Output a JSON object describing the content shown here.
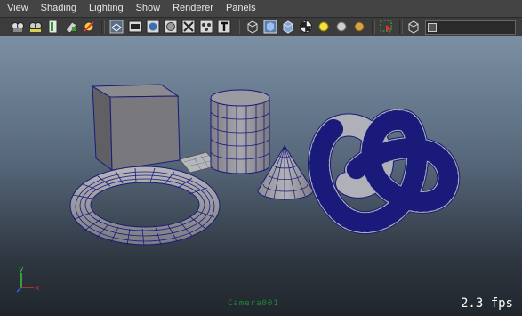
{
  "menubar": {
    "items": [
      {
        "label": "View"
      },
      {
        "label": "Shading"
      },
      {
        "label": "Lighting"
      },
      {
        "label": "Show"
      },
      {
        "label": "Renderer"
      },
      {
        "label": "Panels"
      }
    ]
  },
  "toolbar": {
    "buttons": [
      "camera-select-icon",
      "camera-attributes-icon",
      "bookmark-icon",
      "image-plane-icon",
      "2d-pan-zoom-icon",
      "grid-icon",
      "film-gate-icon",
      "resolution-gate-icon",
      "gate-mask-icon",
      "field-chart-icon",
      "safe-action-icon",
      "safe-title-icon",
      "wireframe-icon",
      "smooth-shade-icon",
      "flat-shade-icon",
      "checker-icon",
      "default-light-icon",
      "all-lights-icon",
      "selected-lights-icon",
      "isolate-select-icon",
      "xray-icon",
      "resolution-slider-icon"
    ]
  },
  "viewport": {
    "fps": "2.3 fps",
    "camera_name": "Camera001",
    "axis_labels": {
      "y": "y",
      "x": "x"
    },
    "colors": {
      "wire": "#1a1a7a",
      "surface": "#8e8e8e",
      "surface_dark": "#6e6e6e"
    }
  }
}
